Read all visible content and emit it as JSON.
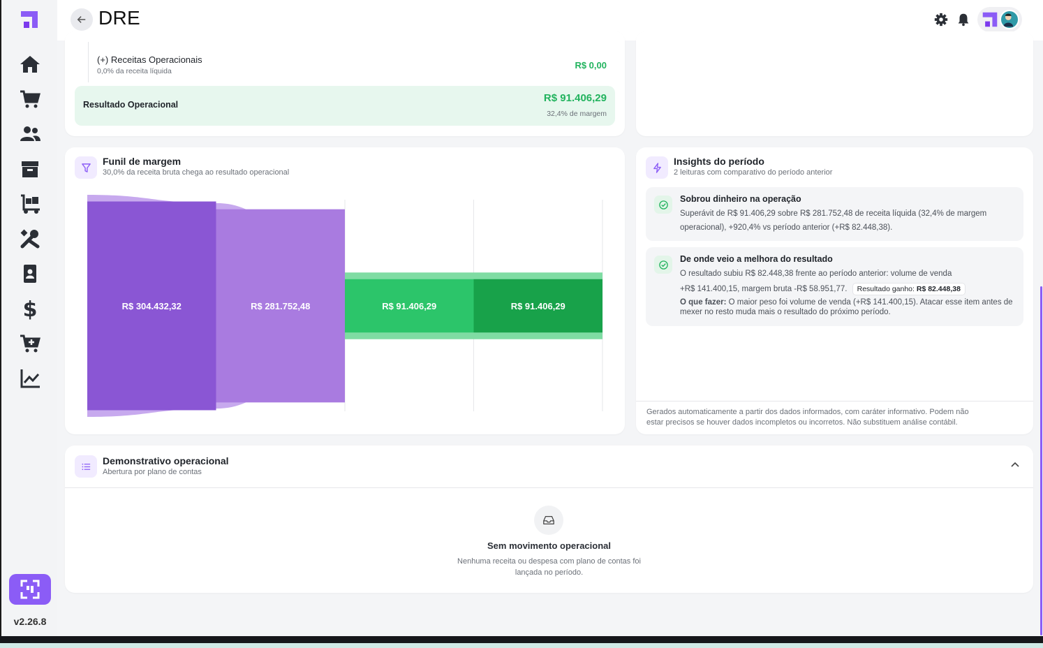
{
  "app": {
    "version": "v2.26.8",
    "accent": "#8b5cf6"
  },
  "header": {
    "title": "DRE"
  },
  "top_card": {
    "row_label": "(+) Receitas Operacionais",
    "row_sub": "0,0% da receita líquida",
    "row_value": "R$ 0,00",
    "result_label": "Resultado Operacional",
    "result_value": "R$ 91.406,29",
    "result_sub": "32,4% de margem"
  },
  "funnel": {
    "title": "Funil de margem",
    "subtitle": "30,0% da receita bruta chega ao resultado operacional"
  },
  "chart_data": {
    "type": "funnel",
    "stages": [
      {
        "value": 304432.32,
        "label": "R$ 304.432,32"
      },
      {
        "value": 281752.48,
        "label": "R$ 281.752,48"
      },
      {
        "value": 91406.29,
        "label": "R$ 91.406,29"
      },
      {
        "value": 91406.29,
        "label": "R$ 91.406,29"
      }
    ],
    "colors": [
      "#8a56d4",
      "#a97be0",
      "#2cc56a",
      "#18a24a"
    ]
  },
  "insights": {
    "title": "Insights do período",
    "subtitle": "2 leituras com comparativo do período anterior",
    "items": [
      {
        "title": "Sobrou dinheiro na operação",
        "line1": "Superávit de R$ 91.406,29 sobre R$ 281.752,48 de receita líquida (32,4% de margem",
        "line2": "operacional), +920,4% vs período anterior (+R$ 82.448,38)."
      },
      {
        "title": "De onde veio a melhora do resultado",
        "line1": "O resultado subiu R$ 82.448,38 frente ao período anterior: volume de venda",
        "line2": "+R$ 141.400,15, margem bruta -R$ 58.951,77.",
        "chip_label": "Resultado ganho:",
        "chip_value": "R$ 82.448,38",
        "todo_label": "O que fazer:",
        "todo_line1": " O maior peso foi volume de venda (+R$ 141.400,15). Atacar esse item antes de",
        "todo_line2": "mexer no resto muda mais o resultado do próximo período."
      }
    ],
    "footer_line1": "Gerados automaticamente a partir dos dados informados, com caráter informativo. Podem não",
    "footer_line2": "estar precisos se houver dados incompletos ou incorretos. Não substituem análise contábil."
  },
  "statement": {
    "title": "Demonstrativo operacional",
    "subtitle": "Abertura por plano de contas",
    "empty_title": "Sem movimento operacional",
    "empty_line1": "Nenhuma receita ou despesa com plano de contas foi",
    "empty_line2": "lançada no período."
  },
  "icons": [
    "logo-icon",
    "home-icon",
    "cart-icon",
    "users-icon",
    "box-icon",
    "dolly-icon",
    "tools-icon",
    "contact-icon",
    "dollar-icon",
    "cart-plus-icon",
    "chart-line-icon",
    "gear-icon",
    "bell-icon",
    "filter-icon",
    "bolt-icon",
    "check-icon",
    "list-icon",
    "inbox-icon",
    "chevron-up-icon",
    "arrow-left-icon"
  ]
}
